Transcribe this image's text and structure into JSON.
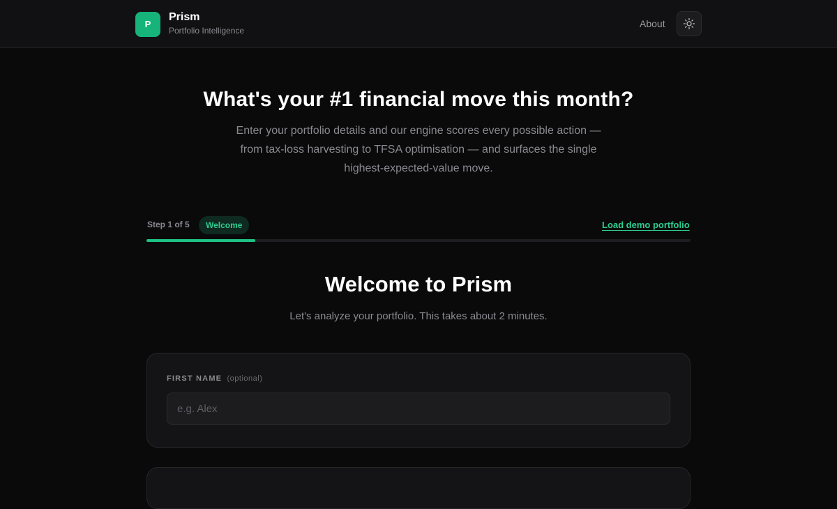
{
  "header": {
    "logo_letter": "P",
    "app_name": "Prism",
    "tagline": "Portfolio Intelligence",
    "about_label": "About",
    "theme_icon": "sun-icon"
  },
  "hero": {
    "title": "What's your #1 financial move this month?",
    "subtitle": "Enter your portfolio details and our engine scores every possible action — from tax-loss harvesting to TFSA optimisation — and surfaces the single highest-expected-value move."
  },
  "stepper": {
    "step_text": "Step 1 of 5",
    "current_step": "Welcome",
    "progress_fraction": 0.2,
    "demo_link": "Load demo portfolio"
  },
  "welcome": {
    "title": "Welcome to Prism",
    "subtitle": "Let's analyze your portfolio. This takes about 2 minutes."
  },
  "form": {
    "first_name_label": "FIRST NAME",
    "first_name_optional": "(optional)",
    "first_name_value": "",
    "first_name_placeholder": "e.g. Alex"
  },
  "colors": {
    "accent": "#1ec184",
    "background": "#0a0a0b",
    "surface": "#141416"
  }
}
